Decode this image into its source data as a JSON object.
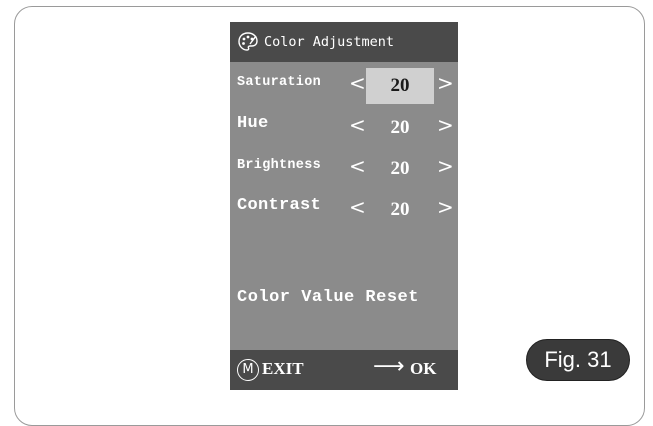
{
  "panel": {
    "title": "Color Adjustment",
    "title_icon": "palette-icon",
    "rows": [
      {
        "label": "Saturation",
        "value": "20",
        "selected": true,
        "prev": "<",
        "next": ">"
      },
      {
        "label": "Hue",
        "value": "20",
        "selected": false,
        "prev": "<",
        "next": ">"
      },
      {
        "label": "Brightness",
        "value": "20",
        "selected": false,
        "prev": "<",
        "next": ">"
      },
      {
        "label": "Contrast",
        "value": "20",
        "selected": false,
        "prev": "<",
        "next": ">"
      }
    ],
    "reset_label": "Color Value Reset",
    "footer": {
      "menu_key": "M",
      "exit_label": "EXIT",
      "arrow": "⟶",
      "ok_label": "OK"
    }
  },
  "figure_label": "Fig. 31",
  "colors": {
    "panel_bg": "#8b8b8b",
    "bar_bg": "#4a4a4a",
    "selected_bg": "#d0d0d0",
    "badge_bg": "#3a3a3a"
  }
}
